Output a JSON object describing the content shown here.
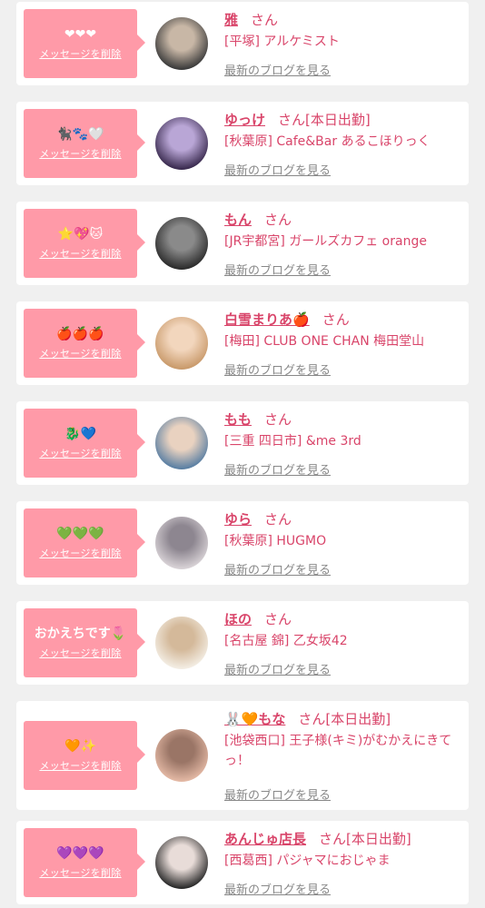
{
  "colors": {
    "accent": "#d9456a",
    "bubble": "#ff9aa8",
    "link_gray": "#888888",
    "background": "#f0f0f0"
  },
  "delete_label": "メッセージを削除",
  "blog_label": "最新のブログを見る",
  "san_label": "さん",
  "items": [
    {
      "message": "❤❤❤",
      "name": "雅",
      "status": "",
      "shop": "[平塚] アルケミスト",
      "avatar_colors": [
        "#3b3b3b",
        "#c8b7a6"
      ]
    },
    {
      "message": "🐈‍⬛🐾🤍",
      "name": "ゆっけ",
      "status": "[本日出勤]",
      "shop": "[秋葉原] Cafe&Bar あるこほりっく",
      "avatar_colors": [
        "#3a2b4f",
        "#b9a6d6"
      ]
    },
    {
      "message": "⭐💖🐱",
      "name": "もん",
      "status": "",
      "shop": "[JR宇都宮] ガールズカフェ orange",
      "avatar_colors": [
        "#2c2c2c",
        "#8a8a8a"
      ]
    },
    {
      "message": "🍎🍎🍎",
      "name": "白雪まりあ🍎",
      "status": "",
      "shop": "[梅田] CLUB ONE CHAN 梅田堂山",
      "avatar_colors": [
        "#c99a6b",
        "#f2d6bd"
      ]
    },
    {
      "message": "🐉💙",
      "name": "もも",
      "status": "",
      "shop": "[三重 四日市] &me 3rd",
      "avatar_colors": [
        "#5a7fa3",
        "#e9d2c0"
      ]
    },
    {
      "message": "💚💚💚",
      "name": "ゆら",
      "status": "",
      "shop": "[秋葉原] HUGMO",
      "avatar_colors": [
        "#d8d2d6",
        "#8d8690"
      ]
    },
    {
      "message": "おかえちです🌷",
      "name": "ほの",
      "status": "",
      "shop": "[名古屋 錦] 乙女坂42",
      "avatar_colors": [
        "#f3ede3",
        "#d4b99a"
      ]
    },
    {
      "message": "🧡✨",
      "name": "🐰🧡もな",
      "status": "[本日出勤]",
      "shop": "[池袋西口] 王子様(キミ)がむかえにきてっ！",
      "avatar_colors": [
        "#e3b8a4",
        "#9a7566"
      ]
    },
    {
      "message": "💜💜💜",
      "name": "あんじゅ店長",
      "status": "[本日出勤]",
      "shop": "[西葛西] パジャマにおじゃま",
      "avatar_colors": [
        "#2a2a2a",
        "#e8dcd8"
      ]
    }
  ]
}
